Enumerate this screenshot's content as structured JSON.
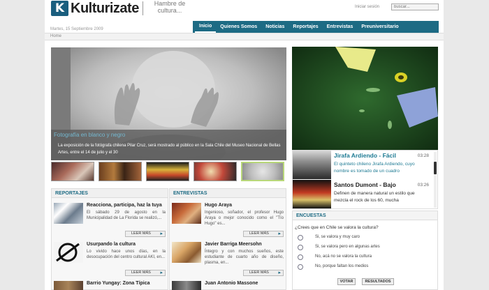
{
  "header": {
    "logo_letter": "K",
    "logo_text": "Kulturizate",
    "tagline": "Hambre de cultura...",
    "login_label": "Iniciar sesión",
    "search_placeholder": "buscar..."
  },
  "date": "Martes, 15 Septiembre 2009",
  "nav": {
    "items": [
      {
        "label": "Inicio",
        "active": true
      },
      {
        "label": "Quienes Somos"
      },
      {
        "label": "Noticias"
      },
      {
        "label": "Reportajes"
      },
      {
        "label": "Entrevistas"
      },
      {
        "label": "Preuniversitario"
      }
    ]
  },
  "breadcrumb": "Home",
  "feature": {
    "title": "Fotografía en blanco y negro",
    "text": "La exposición de la fotógrafa chilena Pilar Cruz, será mostrado al público en la Sala Chile del Museo Nacional de Bellas Artes, entre el 14 de julio y el 30"
  },
  "reportajes": {
    "heading": "REPORTAJES",
    "items": [
      {
        "title": "Reacciona, participa, haz la tuya",
        "text": "El sábado 29 de agosto en la Municipalidad de La Florida se realizó,...",
        "more": "LEER MÁS"
      },
      {
        "title": "Usurpando la cultura",
        "text": "Lo vivido hace unos días, en la desocupación del centro cultural AKI, en...",
        "more": "LEER MÁS"
      },
      {
        "title": "Barrio Yungay: Zona Típica"
      }
    ]
  },
  "entrevistas": {
    "heading": "ENTREVISTAS",
    "items": [
      {
        "title": "Hugo Araya",
        "text": "Ingenioso, soñador, el profesor Hugo Araya o mejor conocido como el \"Tío Hugo\" es...",
        "more": "LEER MÁS"
      },
      {
        "title": "Javier Barriga Meersohn",
        "text": "Íntegro y con muchos sueños, este estudiante de cuarto año de diseño, plasma, en...",
        "more": "LEER MÁS"
      },
      {
        "title": "Juan Antonio Massone"
      }
    ]
  },
  "playlist": [
    {
      "title": "Jirafa Ardiendo - Fácil",
      "time": "03:28",
      "desc": "El quinteto chileno Jirafa Ardiendo, cuyo nombre es tomado de un cuadro",
      "title_color": "#1d7a93",
      "desc_color": "#1d7a93"
    },
    {
      "title": "Santos Dumont - Bajo",
      "time": "03:26",
      "desc": "Definen de manera natural un estilo que mezcla el rock de los 60, mucha",
      "title_color": "#222222",
      "desc_color": "#333333"
    }
  ],
  "poll": {
    "heading": "ENCUESTAS",
    "question": "¿Crees que en Chile se valora la cultura?",
    "options": [
      "Si, se valora y muy caro",
      "Si, se valora pero en algunas artes",
      "No, acá no se valora la cultura",
      "No, porque faltan los medios"
    ],
    "vote_label": "VOTAR",
    "results_label": "RESULTADOS"
  },
  "colors": {
    "accent": "#1d6b84",
    "link": "#74b8d0"
  }
}
